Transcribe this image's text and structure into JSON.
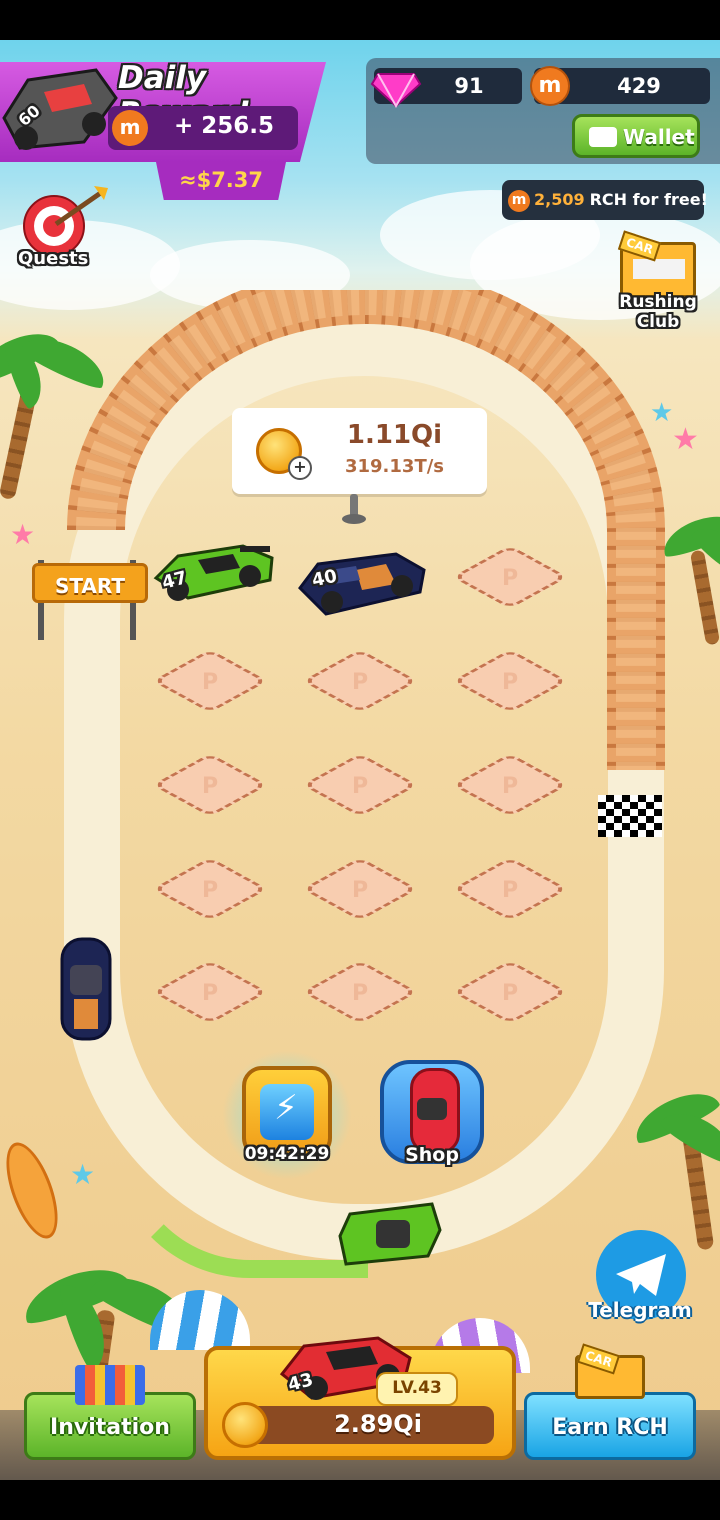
{
  "daily_reward": {
    "title": "Daily Reward",
    "amount": "+ 256.5",
    "usd_value": "≈$7.37",
    "car_number": "60"
  },
  "currencies": {
    "gems": "91",
    "rch": "429",
    "rch_icon_letter": "m"
  },
  "wallet": {
    "label": "Wallet"
  },
  "free_rch_banner": {
    "amount": "2,509",
    "suffix": " RCH for free!"
  },
  "quests": {
    "label": "Quests"
  },
  "rushing_club": {
    "label_line1": "Rushing",
    "label_line2": "Club",
    "sign": "CAR"
  },
  "income": {
    "total": "1.11Qi",
    "rate": "319.13T/s"
  },
  "start_gate": {
    "label": "START"
  },
  "parked_cars": [
    {
      "number": "47",
      "color": "#58b81e"
    },
    {
      "number": "40",
      "color": "#1d2554"
    }
  ],
  "slot_marker": "P",
  "boost": {
    "timer": "09:42:29"
  },
  "shop": {
    "label": "Shop"
  },
  "telegram": {
    "label": "Telegram"
  },
  "bottom": {
    "invitation": "Invitation",
    "level": "LV.43",
    "car_number": "43",
    "price": "2.89Qi",
    "earn_rch": "Earn RCH",
    "earn_sign": "CAR"
  },
  "colors": {
    "daily_reward_bg": "#c43fd3",
    "wallet_green": "#54b52a",
    "rch_orange": "#f07a1f",
    "gem_pink": "#ff3cc8",
    "telegram_blue": "#1e9be4"
  }
}
